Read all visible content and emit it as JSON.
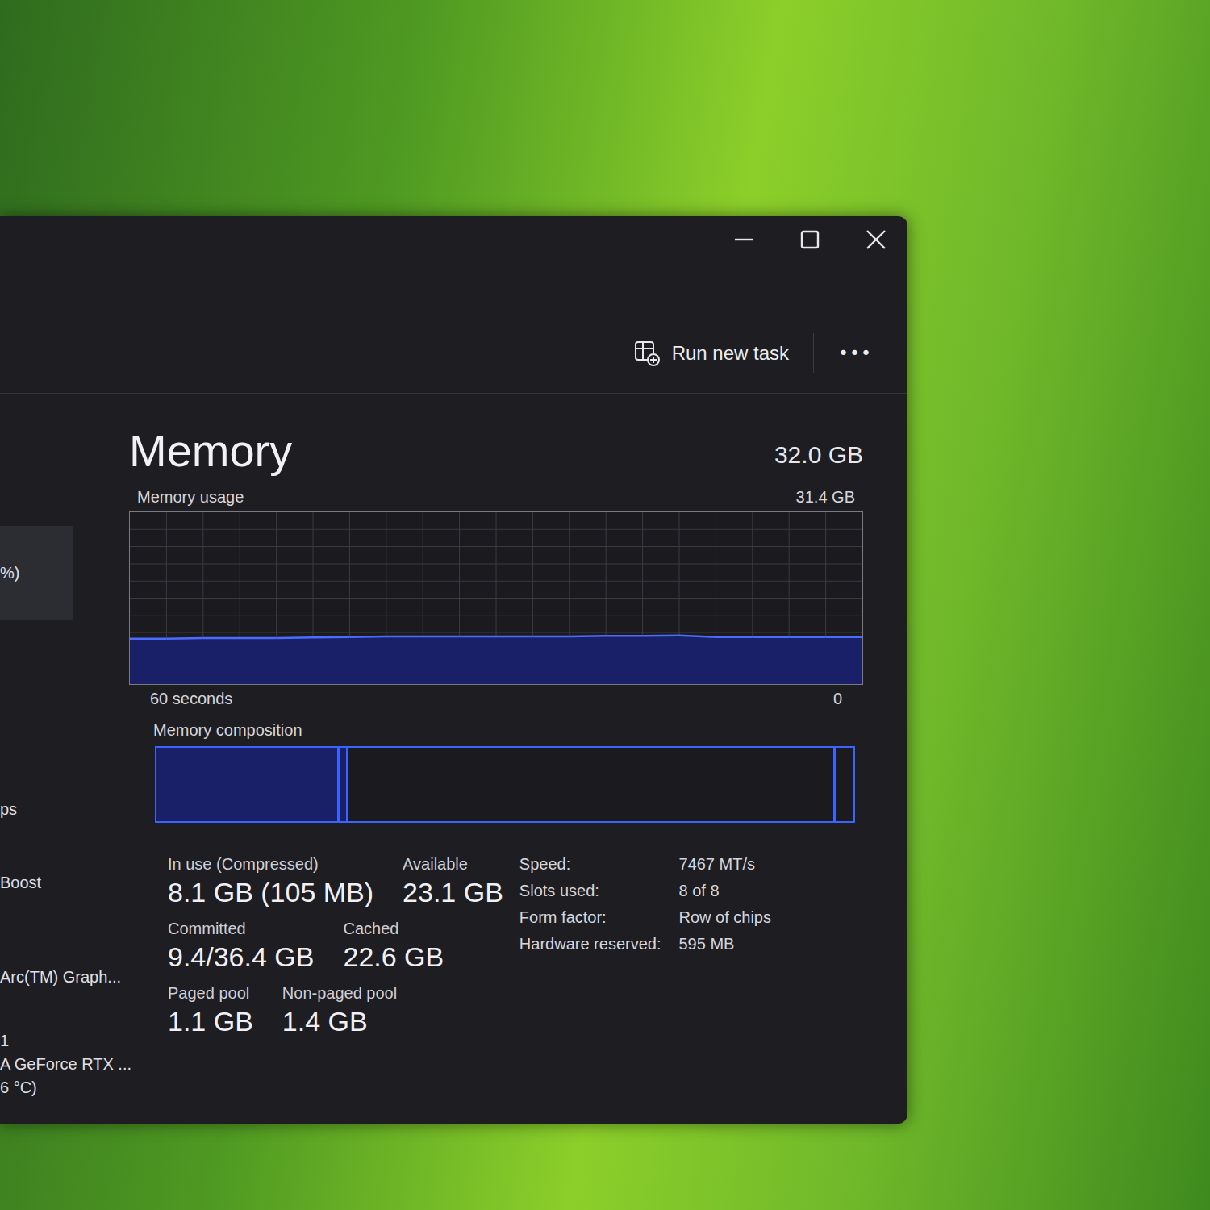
{
  "toolbar": {
    "run_new_task": "Run new task",
    "more": "•••"
  },
  "sidebar": {
    "items": [
      {
        "lines": [
          "%)"
        ],
        "selected": true
      },
      {
        "lines": [
          "ps"
        ],
        "selected": false
      },
      {
        "lines": [
          "Boost"
        ],
        "selected": false
      },
      {
        "lines": [
          "Arc(TM) Graph..."
        ],
        "selected": false
      },
      {
        "lines": [
          "1",
          "A GeForce RTX ...",
          "6 °C)"
        ],
        "selected": false
      }
    ]
  },
  "header": {
    "title": "Memory",
    "total": "32.0 GB"
  },
  "usage_chart": {
    "label": "Memory usage",
    "max_label": "31.4 GB",
    "max": 31.4,
    "values": [
      8.3,
      8.3,
      8.4,
      8.4,
      8.4,
      8.5,
      8.6,
      8.7,
      8.7,
      8.7,
      8.7,
      8.7,
      8.7,
      8.8,
      8.8,
      8.9,
      8.6,
      8.6,
      8.6,
      8.6,
      8.6
    ],
    "x_start": "60 seconds",
    "x_end": "0"
  },
  "composition": {
    "label": "Memory composition",
    "segments": [
      {
        "kind": "filled",
        "level": 0.263
      },
      {
        "kind": "filled",
        "level": 0.012
      },
      {
        "kind": "outline",
        "level": 0.7
      },
      {
        "kind": "outline",
        "level": 0.025
      }
    ]
  },
  "stats": [
    [
      {
        "label": "In use (Compressed)",
        "value": "8.1 GB (105 MB)"
      },
      {
        "label": "Available",
        "value": "23.1 GB"
      }
    ],
    [
      {
        "label": "Committed",
        "value": "9.4/36.4 GB"
      },
      {
        "label": "Cached",
        "value": "22.6 GB"
      }
    ],
    [
      {
        "label": "Paged pool",
        "value": "1.1 GB"
      },
      {
        "label": "Non-paged pool",
        "value": "1.4 GB"
      }
    ]
  ],
  "details": [
    {
      "label": "Speed:",
      "value": "7467 MT/s"
    },
    {
      "label": "Slots used:",
      "value": "8 of 8"
    },
    {
      "label": "Form factor:",
      "value": "Row of chips"
    },
    {
      "label": "Hardware reserved:",
      "value": "595 MB"
    }
  ]
}
